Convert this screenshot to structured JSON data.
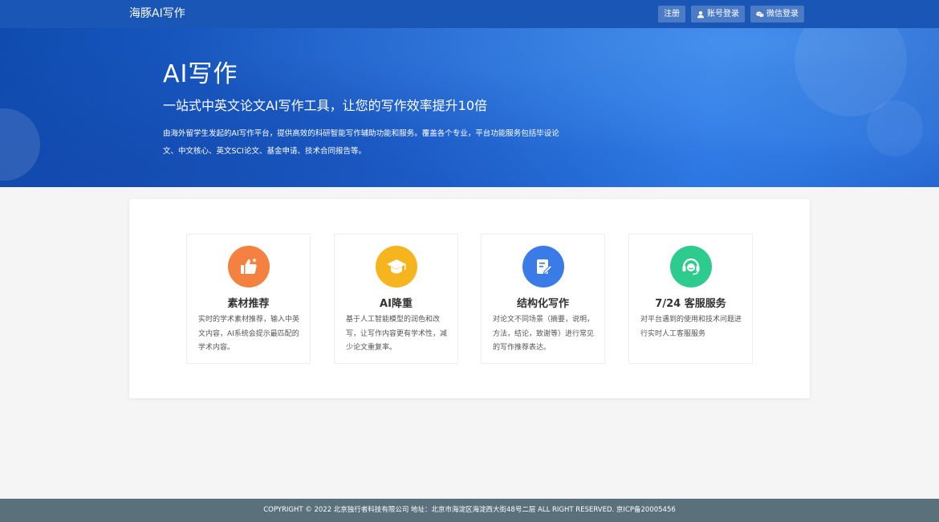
{
  "navbar": {
    "brand": "海豚AI写作",
    "buttons": {
      "register": "注册",
      "account_login": "账号登录",
      "wechat_login": "微信登录"
    }
  },
  "hero": {
    "title": "AI写作",
    "subtitle": "一站式中英文论文AI写作工具，让您的写作效率提升10倍",
    "description": "由海外留学生发起的AI写作平台，提供高效的科研智能写作辅助功能和服务。覆盖各个专业，平台功能服务包括毕设论文、中文核心、英文SCI论文、基金申请、技术合同报告等。"
  },
  "features": [
    {
      "title": "素材推荐",
      "description": "实时的学术素材推荐，输入中英文内容，AI系统会提示最匹配的学术内容。",
      "icon": "thumbs-up-icon",
      "color": "#f4813f"
    },
    {
      "title": "AI降重",
      "description": "基于人工智能模型的润色和改写，让写作内容更有学术性，减少论文重复率。",
      "icon": "graduation-cap-icon",
      "color": "#f6b41f"
    },
    {
      "title": "结构化写作",
      "description": "对论文不同场景（摘要，说明，方法，结论，致谢等）进行常见的写作推荐表达。",
      "icon": "edit-document-icon",
      "color": "#3b7be8"
    },
    {
      "title": "7/24 客服服务",
      "description": "对平台遇到的使用和技术问题进行实时人工客服服务",
      "icon": "customer-service-icon",
      "color": "#2ecb8f"
    }
  ],
  "footer": {
    "text": "COPYRIGHT © 2022 北京独行者科技有限公司 地址：北京市海淀区海淀西大街48号二层 ALL RIGHT RESERVED. 京ICP备20005456"
  }
}
